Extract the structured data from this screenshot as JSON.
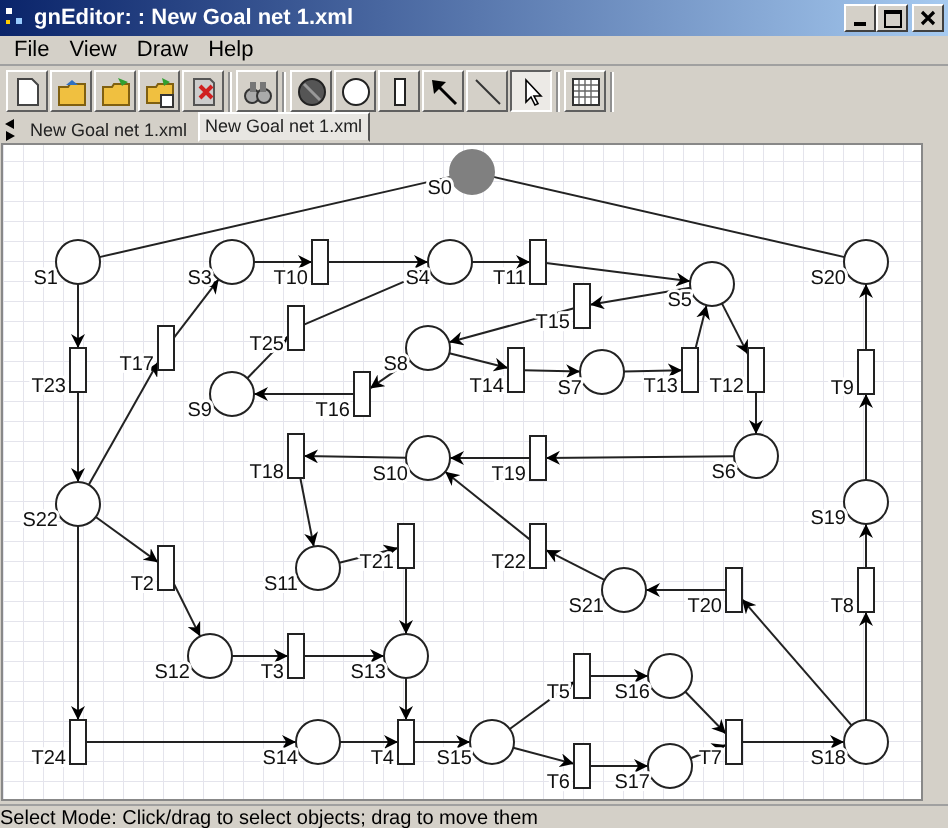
{
  "window": {
    "title": "gnEditor: : New Goal net 1.xml"
  },
  "menu": [
    "File",
    "View",
    "Draw",
    "Help"
  ],
  "toolbar": [
    [
      {
        "kind": "new",
        "selected": false
      },
      {
        "kind": "open",
        "selected": false
      },
      {
        "kind": "load",
        "selected": false
      },
      {
        "kind": "import",
        "selected": false
      },
      {
        "kind": "close",
        "selected": false
      }
    ],
    [
      {
        "kind": "find",
        "selected": false
      }
    ],
    [
      {
        "kind": "token",
        "selected": false
      },
      {
        "kind": "place",
        "selected": false
      },
      {
        "kind": "transition",
        "selected": false
      },
      {
        "kind": "arc",
        "selected": false
      },
      {
        "kind": "line",
        "selected": false
      },
      {
        "kind": "select",
        "selected": true
      }
    ],
    [
      {
        "kind": "grid",
        "selected": false
      }
    ]
  ],
  "tabs": [
    {
      "label": "New Goal net 1.xml",
      "selected": false
    },
    {
      "label": "New Goal net 1.xml",
      "selected": true
    }
  ],
  "nodes": [
    {
      "label": "S0",
      "kind": "place",
      "marked": true
    },
    {
      "label": "S1",
      "kind": "place",
      "marked": false
    },
    {
      "label": "S3",
      "kind": "place",
      "marked": false
    },
    {
      "label": "T10",
      "kind": "transition"
    },
    {
      "label": "S4",
      "kind": "place",
      "marked": false
    },
    {
      "label": "T11",
      "kind": "transition"
    },
    {
      "label": "S20",
      "kind": "place",
      "marked": false
    },
    {
      "label": "S5",
      "kind": "place",
      "marked": false
    },
    {
      "label": "T15",
      "kind": "transition"
    },
    {
      "label": "T25",
      "kind": "transition"
    },
    {
      "label": "T17",
      "kind": "transition"
    },
    {
      "label": "S8",
      "kind": "place",
      "marked": false
    },
    {
      "label": "T23",
      "kind": "transition"
    },
    {
      "label": "T14",
      "kind": "transition"
    },
    {
      "label": "S7",
      "kind": "place",
      "marked": false
    },
    {
      "label": "T13",
      "kind": "transition"
    },
    {
      "label": "T12",
      "kind": "transition"
    },
    {
      "label": "T9",
      "kind": "transition"
    },
    {
      "label": "S9",
      "kind": "place",
      "marked": false
    },
    {
      "label": "T16",
      "kind": "transition"
    },
    {
      "label": "T18",
      "kind": "transition"
    },
    {
      "label": "S10",
      "kind": "place",
      "marked": false
    },
    {
      "label": "T19",
      "kind": "transition"
    },
    {
      "label": "S6",
      "kind": "place",
      "marked": false
    },
    {
      "label": "S22",
      "kind": "place",
      "marked": false
    },
    {
      "label": "S19",
      "kind": "place",
      "marked": false
    },
    {
      "label": "T21",
      "kind": "transition"
    },
    {
      "label": "T22",
      "kind": "transition"
    },
    {
      "label": "S11",
      "kind": "place",
      "marked": false
    },
    {
      "label": "T2",
      "kind": "transition"
    },
    {
      "label": "S21",
      "kind": "place",
      "marked": false
    },
    {
      "label": "T20",
      "kind": "transition"
    },
    {
      "label": "T8",
      "kind": "transition"
    },
    {
      "label": "S12",
      "kind": "place",
      "marked": false
    },
    {
      "label": "T3",
      "kind": "transition"
    },
    {
      "label": "S13",
      "kind": "place",
      "marked": false
    },
    {
      "label": "T5",
      "kind": "transition"
    },
    {
      "label": "S16",
      "kind": "place",
      "marked": false
    },
    {
      "label": "T24",
      "kind": "transition"
    },
    {
      "label": "S14",
      "kind": "place",
      "marked": false
    },
    {
      "label": "T4",
      "kind": "transition"
    },
    {
      "label": "S15",
      "kind": "place",
      "marked": false
    },
    {
      "label": "T7",
      "kind": "transition"
    },
    {
      "label": "S18",
      "kind": "place",
      "marked": false
    },
    {
      "label": "T6",
      "kind": "transition"
    },
    {
      "label": "S17",
      "kind": "place",
      "marked": false
    }
  ],
  "status_bar": "Select Mode: Click/drag to select objects; drag to move them"
}
